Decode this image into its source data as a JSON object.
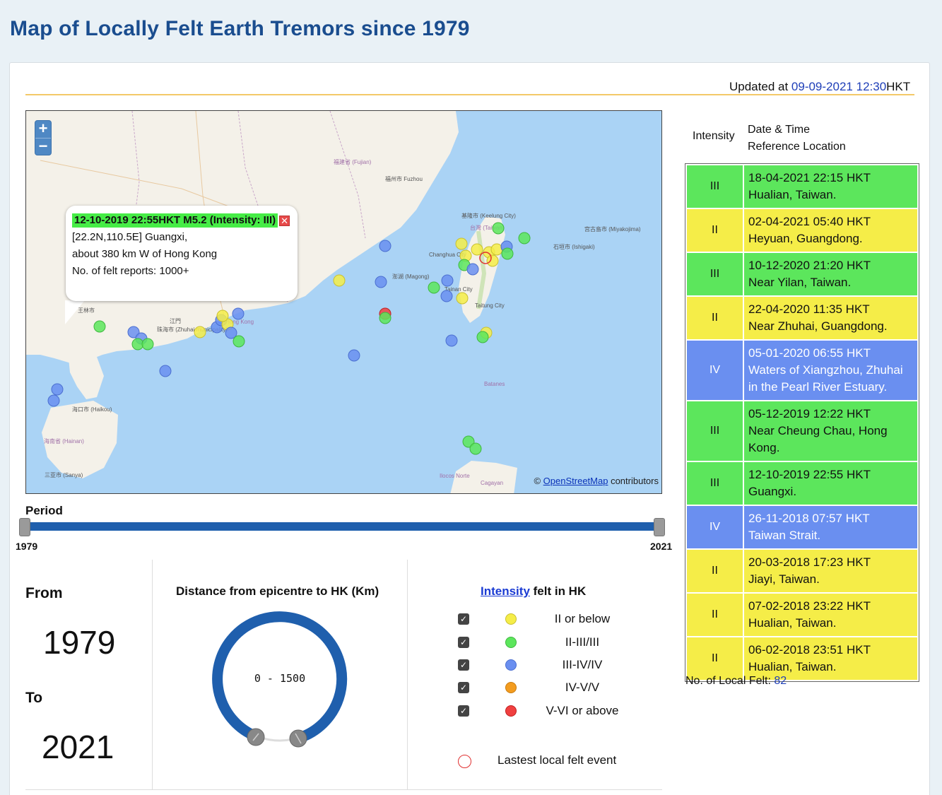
{
  "page": {
    "title": "Map of Locally Felt Earth Tremors since 1979"
  },
  "updated": {
    "prefix": "Updated at ",
    "date": "09-09-2021",
    "time": "12:30",
    "suffix": "HKT"
  },
  "map": {
    "zoom_in": "+",
    "zoom_out": "−",
    "attribution_prefix": "© ",
    "attribution_link": "OpenStreetMap",
    "attribution_suffix": " contributors",
    "labels": [
      "福建省 (Fujian)",
      "台灣 (Taiwan)",
      "海南省 (Hainan)",
      "Batanes",
      "Ilocos Norte",
      "Cagayan",
      "澎湖 (Magong)",
      "石垣市 (Ishigaki)",
      "宫古島市 (Miyakojima)",
      "海口市 (Haikou)",
      "三亚市 (Sanya)",
      "Taitung City",
      "Tainan City",
      "Changhua City",
      "基隆市 (Keelung City)",
      "福州市 Fuzhou",
      "江門",
      "珠海市 (Zhuhai municipality)",
      "Hong Kong",
      "王林市"
    ],
    "popup": {
      "headline": "12-10-2019 22:55HKT M5.2 (Intensity: III)",
      "close": "✕",
      "line1": "[22.2N,110.5E] Guangxi,",
      "line2": "about 380 km W of Hong Kong",
      "line3": "No. of felt reports: 1000+"
    }
  },
  "period": {
    "label": "Period",
    "min": "1979",
    "max": "2021"
  },
  "range": {
    "from_label": "From",
    "from_year": "1979",
    "to_label": "To",
    "to_year": "2021"
  },
  "distance": {
    "title": "Distance from epicentre to HK (Km)",
    "value": "0 - 1500"
  },
  "intensity_legend": {
    "title_link": "Intensity",
    "title_rest": " felt in HK",
    "items": [
      {
        "label": "II or below",
        "color": "#f5ed48",
        "checked": "✓"
      },
      {
        "label": "II-III/III",
        "color": "#5ce65c",
        "checked": "✓"
      },
      {
        "label": "III-IV/IV",
        "color": "#6a8ff0",
        "checked": "✓"
      },
      {
        "label": "IV-V/V",
        "color": "#f39c1f",
        "checked": "✓"
      },
      {
        "label": "V-VI or above",
        "color": "#f04040",
        "checked": "✓"
      }
    ],
    "latest_label": "Lastest local felt event"
  },
  "table": {
    "header_intensity": "Intensity",
    "header_datetime": "Date & Time",
    "header_location": "Reference Location",
    "rows": [
      {
        "intensity": "III",
        "datetime": "18-04-2021 22:15 HKT",
        "location": "Hualian, Taiwan.",
        "color": "green"
      },
      {
        "intensity": "II",
        "datetime": "02-04-2021 05:40 HKT",
        "location": "Heyuan, Guangdong.",
        "color": "yellow"
      },
      {
        "intensity": "III",
        "datetime": "10-12-2020 21:20 HKT",
        "location": "Near Yilan, Taiwan.",
        "color": "green"
      },
      {
        "intensity": "II",
        "datetime": "22-04-2020 11:35 HKT",
        "location": "Near Zhuhai, Guangdong.",
        "color": "yellow"
      },
      {
        "intensity": "IV",
        "datetime": "05-01-2020 06:55 HKT",
        "location": "Waters of Xiangzhou, Zhuhai in the Pearl River Estuary.",
        "color": "blue"
      },
      {
        "intensity": "III",
        "datetime": "05-12-2019 12:22 HKT",
        "location": "Near Cheung Chau, Hong Kong.",
        "color": "green"
      },
      {
        "intensity": "III",
        "datetime": "12-10-2019 22:55 HKT",
        "location": "Guangxi.",
        "color": "green"
      },
      {
        "intensity": "IV",
        "datetime": "26-11-2018 07:57 HKT",
        "location": "Taiwan Strait.",
        "color": "blue"
      },
      {
        "intensity": "II",
        "datetime": "20-03-2018 17:23 HKT",
        "location": "Jiayi, Taiwan.",
        "color": "yellow"
      },
      {
        "intensity": "II",
        "datetime": "07-02-2018 23:22 HKT",
        "location": "Hualian, Taiwan.",
        "color": "yellow"
      },
      {
        "intensity": "II",
        "datetime": "06-02-2018 23:51 HKT",
        "location": "Hualian, Taiwan.",
        "color": "yellow"
      }
    ],
    "count_label": "No. of Local Felt: ",
    "count_value": "82"
  }
}
